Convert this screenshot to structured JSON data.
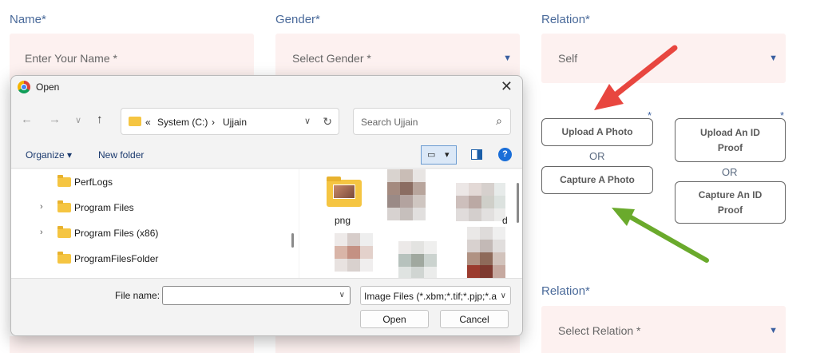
{
  "form": {
    "name_label": "Name*",
    "name_placeholder": "Enter Your Name *",
    "gender_label": "Gender*",
    "gender_placeholder": "Select Gender *",
    "relation_label": "Relation*",
    "relation_value": "Self",
    "relation2_label": "Relation*",
    "relation2_placeholder": "Select Relation *",
    "upload_photo": "Upload A Photo",
    "or_1": "OR",
    "capture_photo": "Capture A Photo",
    "upload_id_line1": "Upload An ID",
    "upload_id_line2": "Proof",
    "or_2": "OR",
    "capture_id_line1": "Capture An ID",
    "capture_id_line2": "Proof",
    "required_mark": "*"
  },
  "dialog": {
    "title": "Open",
    "close_glyph": "✕",
    "nav": {
      "back": "←",
      "forward": "→",
      "recent": "∨",
      "up": "↑"
    },
    "address": {
      "prefix": "«",
      "segment1": "System (C:)",
      "separator": "›",
      "segment2": "Ujjain",
      "dropdown": "∨",
      "refresh": "↻"
    },
    "search_placeholder": "Search Ujjain",
    "search_icon": "⌕",
    "toolbar": {
      "organize": "Organize ▾",
      "new_folder": "New folder",
      "view_glyph": "▭",
      "view_dd": "▾",
      "help": "?"
    },
    "tree": [
      {
        "name": "PerfLogs",
        "expand": ""
      },
      {
        "name": "Program Files",
        "expand": "›"
      },
      {
        "name": "Program Files (x86)",
        "expand": "›"
      },
      {
        "name": "ProgramFilesFolder",
        "expand": ""
      }
    ],
    "files": {
      "folder_name": "png",
      "partial_label": "d"
    },
    "file_name_label": "File name:",
    "file_name_value": "",
    "filter_text": "Image Files (*.xbm;*.tif;*.pjp;*.a",
    "filter_dd": "∨",
    "open_button": "Open",
    "cancel_button": "Cancel"
  },
  "colors": {
    "field_bg": "#fdf1f0",
    "label": "#4a6a9a",
    "red_arrow": "#e8463f",
    "green_arrow": "#6aaa2c"
  }
}
